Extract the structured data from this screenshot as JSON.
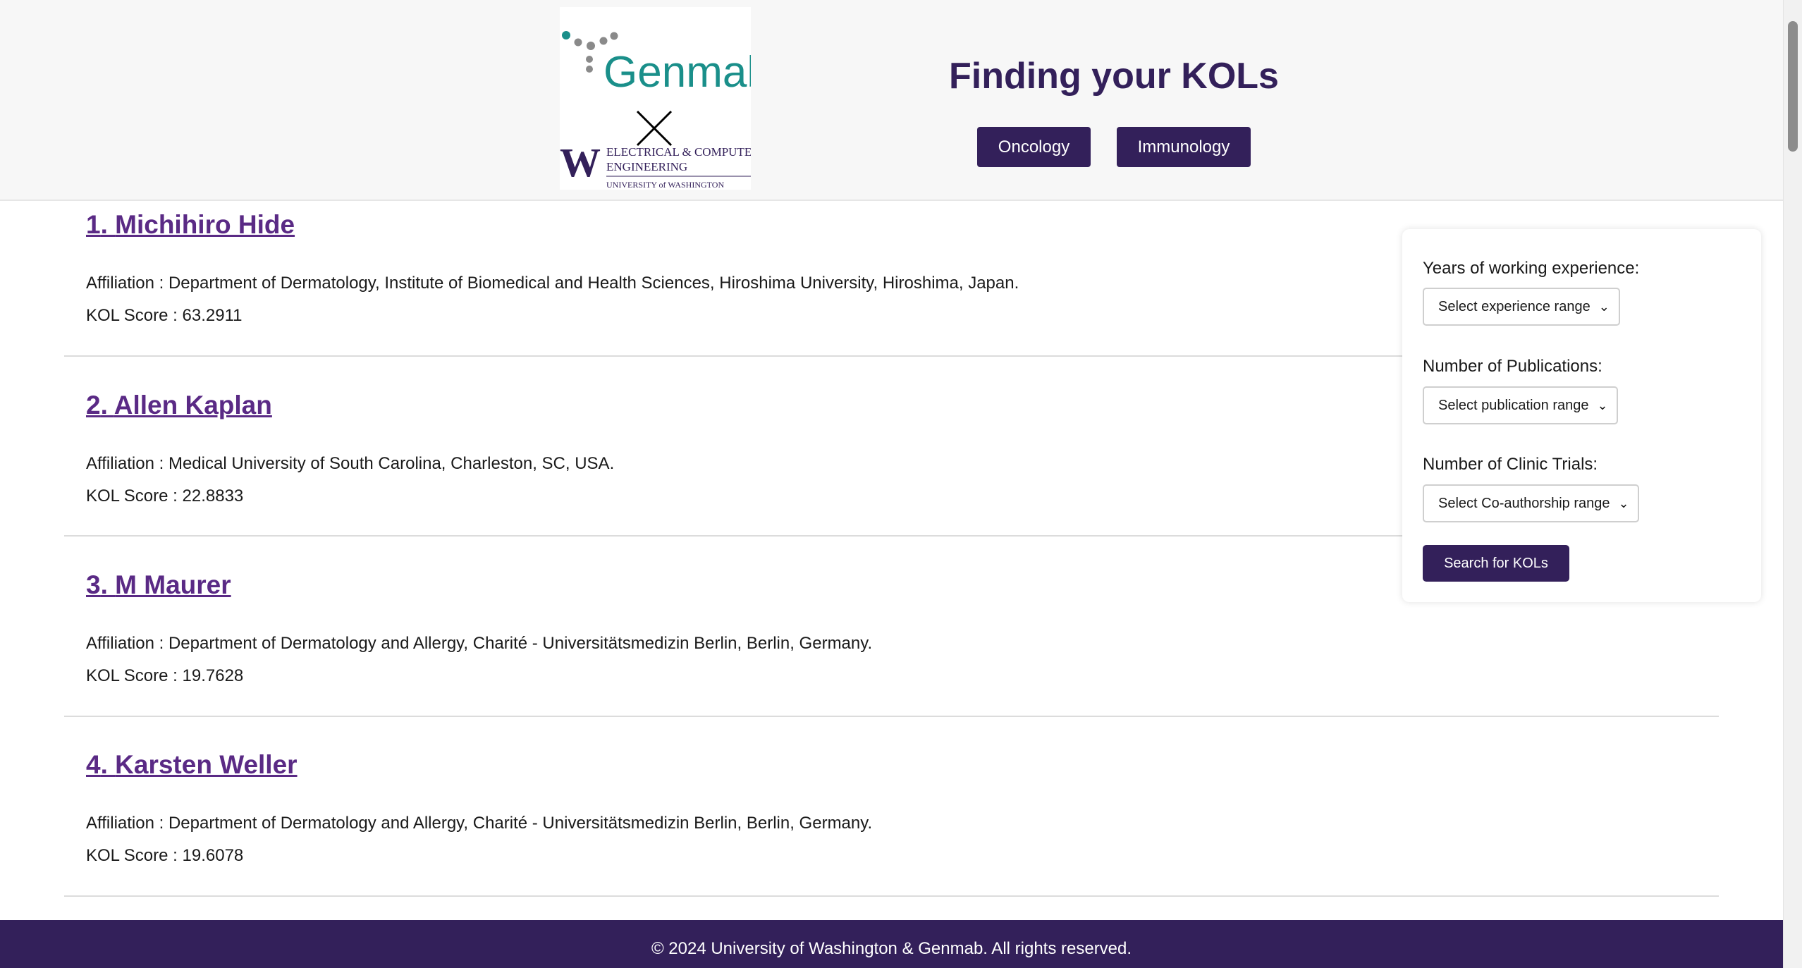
{
  "header": {
    "logo": {
      "brand_text": "Genmab",
      "partner_mark": "W",
      "partner_line1": "ELECTRICAL & COMPUTER",
      "partner_line2": "ENGINEERING",
      "partner_university": "UNIVERSITY of WASHINGTON"
    },
    "title": "Finding your KOLs",
    "nav": [
      "Oncology",
      "Immunology"
    ]
  },
  "results": [
    {
      "rank": "1",
      "name": "Michihiro Hide",
      "affiliation_label": "Affiliation",
      "affiliation": "Department of Dermatology, Institute of Biomedical and Health Sciences, Hiroshima University, Hiroshima, Japan.",
      "score_label": "KOL Score",
      "score": "63.2911"
    },
    {
      "rank": "2",
      "name": "Allen Kaplan",
      "affiliation_label": "Affiliation",
      "affiliation": "Medical University of South Carolina, Charleston, SC, USA.",
      "score_label": "KOL Score",
      "score": "22.8833"
    },
    {
      "rank": "3",
      "name": "M Maurer",
      "affiliation_label": "Affiliation",
      "affiliation": "Department of Dermatology and Allergy, Charité - Universitätsmedizin Berlin, Berlin, Germany.",
      "score_label": "KOL Score",
      "score": "19.7628"
    },
    {
      "rank": "4",
      "name": "Karsten Weller",
      "affiliation_label": "Affiliation",
      "affiliation": "Department of Dermatology and Allergy, Charité - Universitätsmedizin Berlin, Berlin, Germany.",
      "score_label": "KOL Score",
      "score": "19.6078"
    }
  ],
  "filters": {
    "experience": {
      "label": "Years of working experience:",
      "selected": "Select experience range"
    },
    "publications": {
      "label": "Number of Publications:",
      "selected": "Select publication range"
    },
    "trials": {
      "label": "Number of Clinic Trials:",
      "selected": "Select Co-authorship range"
    },
    "search_label": "Search for KOLs"
  },
  "footer": {
    "text": "© 2024 University of Washington & Genmab. All rights reserved."
  },
  "colors": {
    "primary": "#33205a",
    "link": "#5a2a85",
    "genmab_teal": "#1a8f8a",
    "header_bg": "#f7f7f7"
  }
}
